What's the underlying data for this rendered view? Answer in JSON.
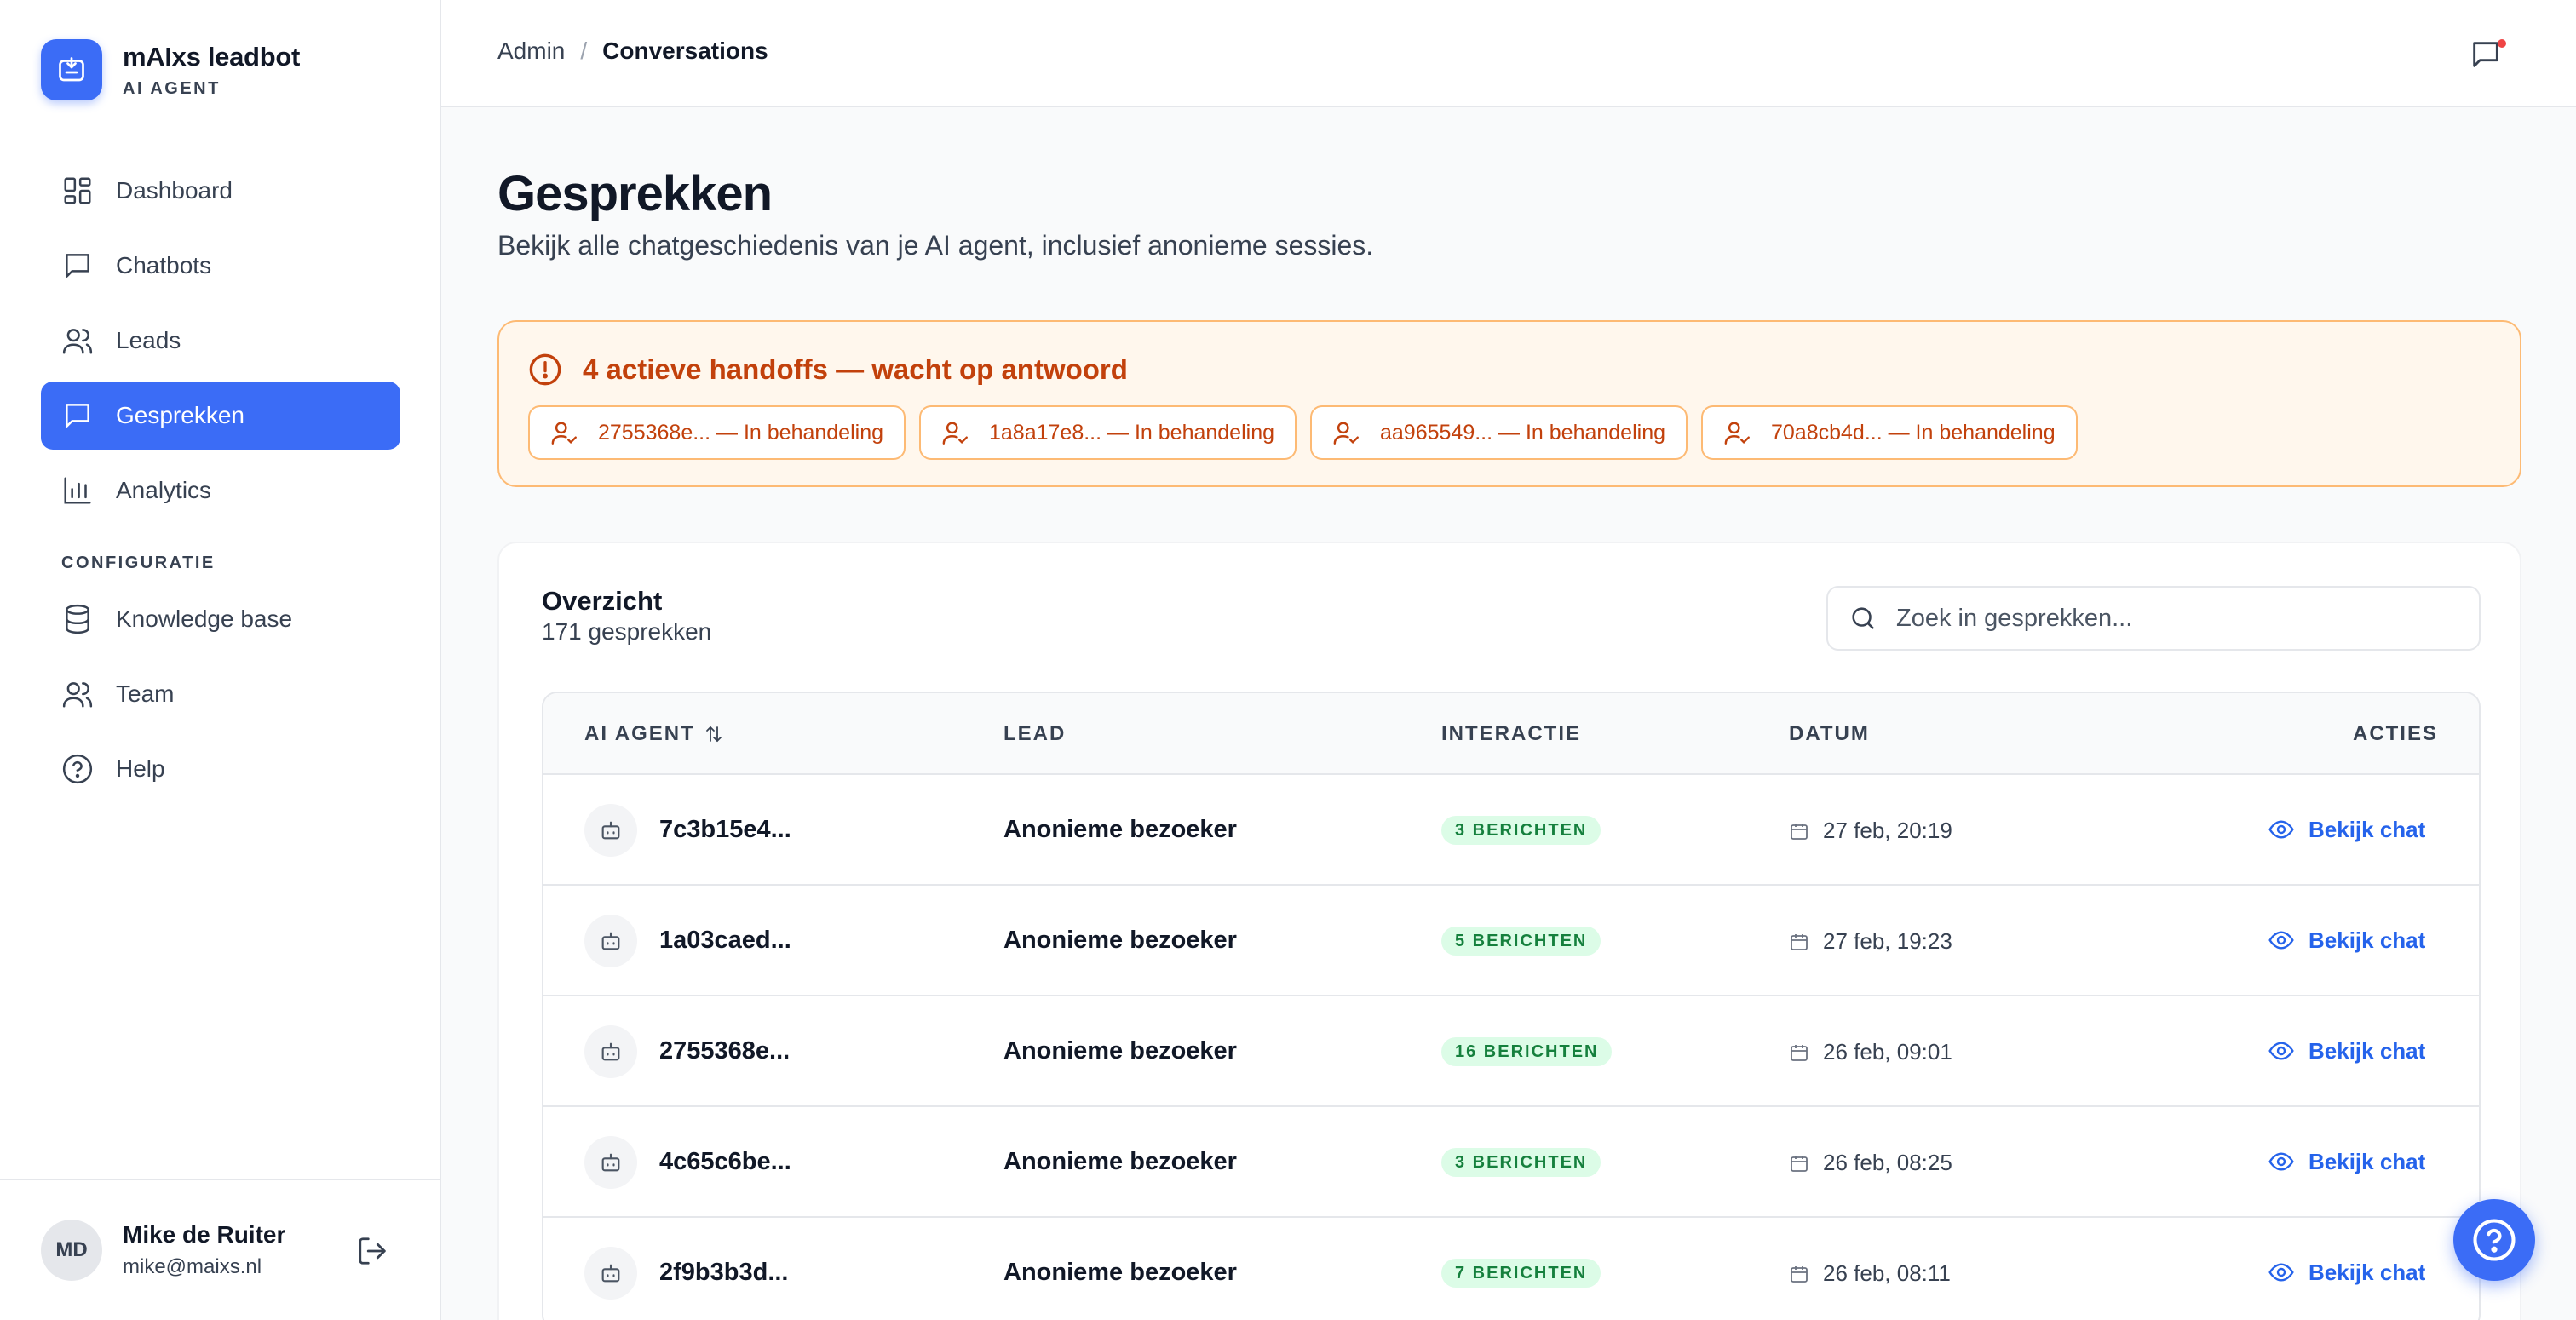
{
  "brand": {
    "name": "mAIxs leadbot",
    "subtitle": "AI AGENT"
  },
  "sidebar": {
    "items": [
      {
        "label": "Dashboard",
        "icon": "dashboard-icon",
        "active": false
      },
      {
        "label": "Chatbots",
        "icon": "chat-icon",
        "active": false
      },
      {
        "label": "Leads",
        "icon": "users-icon",
        "active": false
      },
      {
        "label": "Gesprekken",
        "icon": "chat-icon",
        "active": true
      },
      {
        "label": "Analytics",
        "icon": "bar-chart-icon",
        "active": false
      }
    ],
    "section_label": "CONFIGURATIE",
    "config_items": [
      {
        "label": "Knowledge base",
        "icon": "database-icon"
      },
      {
        "label": "Team",
        "icon": "users-icon"
      },
      {
        "label": "Help",
        "icon": "help-circle-icon"
      }
    ]
  },
  "user": {
    "initials": "MD",
    "name": "Mike de Ruiter",
    "email": "mike@maixs.nl"
  },
  "header": {
    "breadcrumb": [
      "Admin",
      "/",
      "Conversations"
    ]
  },
  "page": {
    "title": "Gesprekken",
    "subtitle": "Bekijk alle chatgeschiedenis van je AI agent, inclusief anonieme sessies."
  },
  "alert": {
    "title": "4 actieve handoffs — wacht op antwoord",
    "chips": [
      "2755368e... — In behandeling",
      "1a8a17e8... — In behandeling",
      "aa965549... — In behandeling",
      "70a8cb4d... — In behandeling"
    ]
  },
  "overview": {
    "title": "Overzicht",
    "count": "171 gesprekken",
    "search_placeholder": "Zoek in gesprekken..."
  },
  "table": {
    "headers": {
      "agent": "AI AGENT",
      "lead": "LEAD",
      "interaction": "INTERACTIE",
      "date": "DATUM",
      "actions": "ACTIES"
    },
    "rows": [
      {
        "agent": "7c3b15e4...",
        "lead": "Anonieme bezoeker",
        "messages": "3 BERICHTEN",
        "date": "27 feb, 20:19",
        "action": "Bekijk chat"
      },
      {
        "agent": "1a03caed...",
        "lead": "Anonieme bezoeker",
        "messages": "5 BERICHTEN",
        "date": "27 feb, 19:23",
        "action": "Bekijk chat"
      },
      {
        "agent": "2755368e...",
        "lead": "Anonieme bezoeker",
        "messages": "16 BERICHTEN",
        "date": "26 feb, 09:01",
        "action": "Bekijk chat"
      },
      {
        "agent": "4c65c6be...",
        "lead": "Anonieme bezoeker",
        "messages": "3 BERICHTEN",
        "date": "26 feb, 08:25",
        "action": "Bekijk chat"
      },
      {
        "agent": "2f9b3b3d...",
        "lead": "Anonieme bezoeker",
        "messages": "7 BERICHTEN",
        "date": "26 feb, 08:11",
        "action": "Bekijk chat"
      }
    ]
  },
  "colors": {
    "accent": "#3b6cf6",
    "warning": "#c2410c",
    "success": "#15803d",
    "link": "#2563eb"
  }
}
